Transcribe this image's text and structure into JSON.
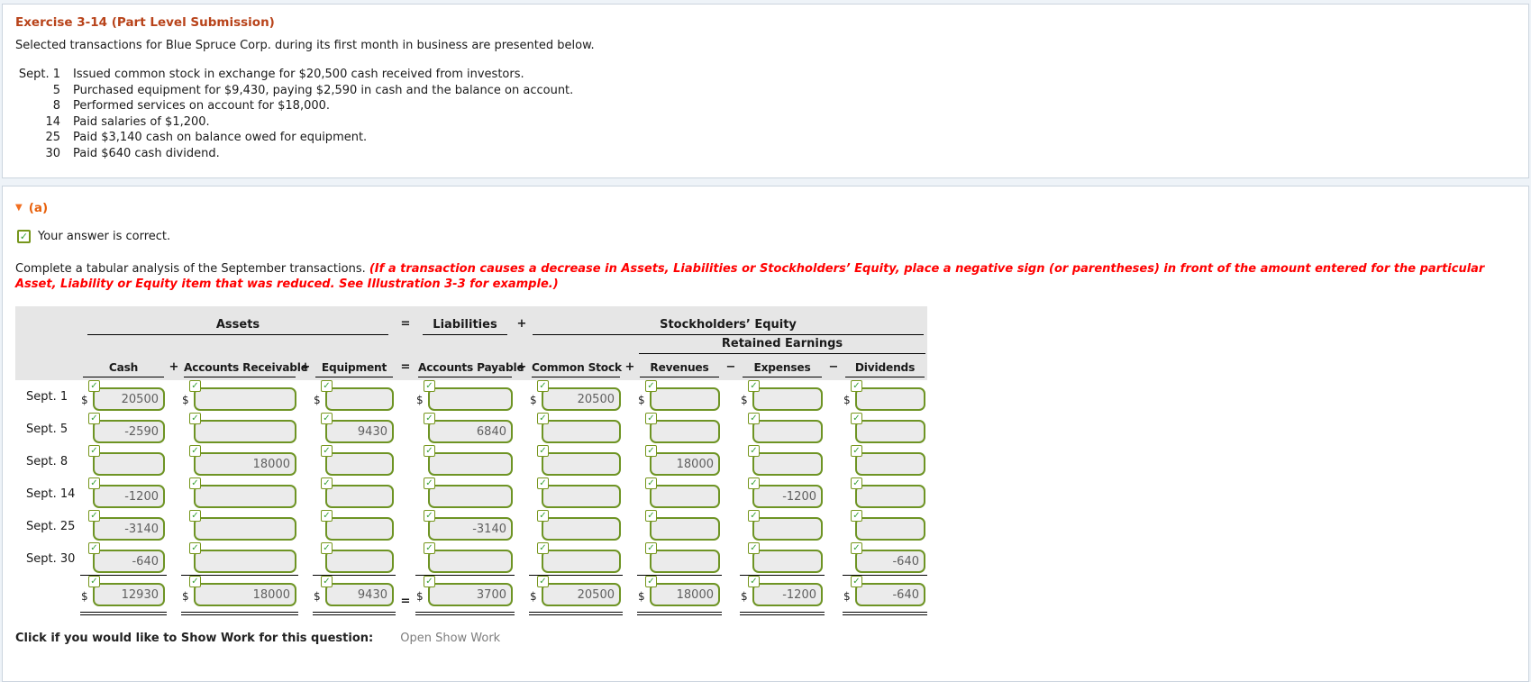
{
  "exercise": {
    "title": "Exercise 3-14 (Part Level Submission)",
    "intro": "Selected transactions for Blue Spruce Corp. during its first month in business are presented below.",
    "transactions": [
      {
        "date": "Sept. 1",
        "desc": "Issued common stock in exchange for $20,500 cash received from investors."
      },
      {
        "date": "5",
        "desc": "Purchased equipment for $9,430, paying $2,590 in cash and the balance on account."
      },
      {
        "date": "8",
        "desc": "Performed services on account for $18,000."
      },
      {
        "date": "14",
        "desc": "Paid salaries of $1,200."
      },
      {
        "date": "25",
        "desc": "Paid $3,140 cash on balance owed for equipment."
      },
      {
        "date": "30",
        "desc": "Paid $640 cash dividend."
      }
    ]
  },
  "part": {
    "label": "(a)",
    "feedback": "Your answer is correct.",
    "instruction_plain": "Complete a tabular analysis of the September transactions. ",
    "instruction_emphasis": "(If a transaction causes a decrease in Assets, Liabilities or Stockholders’ Equity, place a negative sign (or parentheses) in front of the amount entered for the particular Asset, Liability or Equity item that was reduced. See Illustration 3-3 for example.)"
  },
  "table": {
    "groups": {
      "assets": "Assets",
      "liabilities": "Liabilities",
      "equity": "Stockholders’ Equity",
      "retained": "Retained Earnings"
    },
    "group_ops": {
      "equals": "=",
      "plus": "+"
    },
    "columns": [
      "Cash",
      "Accounts Receivable",
      "Equipment",
      "Accounts Payable",
      "Common Stock",
      "Revenues",
      "Expenses",
      "Dividends"
    ],
    "ops": [
      "+",
      "+",
      "=",
      "+",
      "+",
      "−",
      "−"
    ],
    "currency": "$",
    "rows": [
      {
        "key": "sept-1",
        "label": "Sept. 1",
        "dollar": true,
        "values": [
          "20500",
          "",
          "",
          "",
          "20500",
          "",
          "",
          ""
        ]
      },
      {
        "key": "sept-5",
        "label": "Sept. 5",
        "dollar": false,
        "values": [
          "-2590",
          "",
          "9430",
          "6840",
          "",
          "",
          "",
          ""
        ]
      },
      {
        "key": "sept-8",
        "label": "Sept. 8",
        "dollar": false,
        "values": [
          "",
          "18000",
          "",
          "",
          "",
          "18000",
          "",
          ""
        ]
      },
      {
        "key": "sept-14",
        "label": "Sept. 14",
        "dollar": false,
        "values": [
          "-1200",
          "",
          "",
          "",
          "",
          "",
          "-1200",
          ""
        ]
      },
      {
        "key": "sept-25",
        "label": "Sept. 25",
        "dollar": false,
        "values": [
          "-3140",
          "",
          "",
          "-3140",
          "",
          "",
          "",
          ""
        ]
      },
      {
        "key": "sept-30",
        "label": "Sept. 30",
        "dollar": false,
        "values": [
          "-640",
          "",
          "",
          "",
          "",
          "",
          "",
          "-640"
        ]
      }
    ],
    "totals": {
      "key": "total",
      "label": "",
      "dollar": true,
      "equals": "=",
      "values": [
        "12930",
        "18000",
        "9430",
        "3700",
        "20500",
        "18000",
        "-1200",
        "-640"
      ]
    }
  },
  "footer": {
    "show_work_label": "Click if you would like to Show Work for this question:",
    "show_work_link": "Open Show Work"
  },
  "icons": {
    "checkmark": "✓",
    "triangle_down": "▼"
  },
  "colors": {
    "title_red": "#b8431a",
    "part_orange": "#e8610c",
    "instruction_red": "#ff0000",
    "input_border_green": "#6e9424",
    "check_green": "#3aa23a",
    "header_gray": "#e6e6e6",
    "page_bg": "#eef3f8",
    "panel_border": "#cbd4de"
  }
}
